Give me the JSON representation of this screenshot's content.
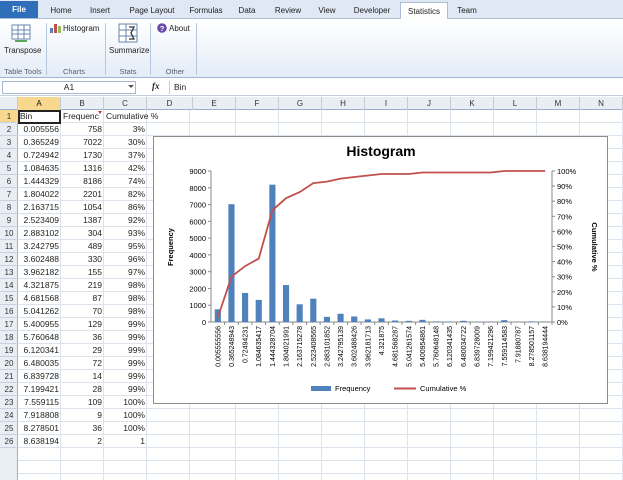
{
  "ribbon_tabs": [
    {
      "label": "File"
    },
    {
      "label": "Home"
    },
    {
      "label": "Insert"
    },
    {
      "label": "Page Layout"
    },
    {
      "label": "Formulas"
    },
    {
      "label": "Data"
    },
    {
      "label": "Review"
    },
    {
      "label": "View"
    },
    {
      "label": "Developer"
    },
    {
      "label": "Statistics"
    },
    {
      "label": "Team"
    }
  ],
  "active_tab": "Statistics",
  "ribbon": {
    "transpose_label": "Transpose",
    "histogram_label": "Histogram",
    "summarize_label": "Summarize",
    "about_label": "About",
    "groups": [
      "Table Tools",
      "Charts",
      "Stats",
      "Other"
    ]
  },
  "formula_bar": {
    "name_box": "A1",
    "fx": "fx",
    "value": "Bin"
  },
  "columns": [
    "A",
    "B",
    "C",
    "D",
    "E",
    "F",
    "G",
    "H",
    "I",
    "J",
    "K",
    "L",
    "M",
    "N"
  ],
  "rows": [
    "1",
    "2",
    "3",
    "4",
    "5",
    "6",
    "7",
    "8",
    "9",
    "10",
    "11",
    "12",
    "13",
    "14",
    "15",
    "16",
    "17",
    "18",
    "19",
    "20",
    "21",
    "22",
    "23",
    "24",
    "25",
    "26"
  ],
  "table": {
    "headers": [
      "Bin",
      "Frequenc",
      "Cumulative %"
    ],
    "rows": [
      [
        "0.005556",
        "758",
        "3%"
      ],
      [
        "0.365249",
        "7022",
        "30%"
      ],
      [
        "0.724942",
        "1730",
        "37%"
      ],
      [
        "1.084635",
        "1316",
        "42%"
      ],
      [
        "1.444329",
        "8186",
        "74%"
      ],
      [
        "1.804022",
        "2201",
        "82%"
      ],
      [
        "2.163715",
        "1054",
        "86%"
      ],
      [
        "2.523409",
        "1387",
        "92%"
      ],
      [
        "2.883102",
        "304",
        "93%"
      ],
      [
        "3.242795",
        "489",
        "95%"
      ],
      [
        "3.602488",
        "330",
        "96%"
      ],
      [
        "3.962182",
        "155",
        "97%"
      ],
      [
        "4.321875",
        "219",
        "98%"
      ],
      [
        "4.681568",
        "87",
        "98%"
      ],
      [
        "5.041262",
        "70",
        "98%"
      ],
      [
        "5.400955",
        "129",
        "99%"
      ],
      [
        "5.760648",
        "36",
        "99%"
      ],
      [
        "6.120341",
        "29",
        "99%"
      ],
      [
        "6.480035",
        "72",
        "99%"
      ],
      [
        "6.839728",
        "14",
        "99%"
      ],
      [
        "7.199421",
        "28",
        "99%"
      ],
      [
        "7.559115",
        "109",
        "100%"
      ],
      [
        "7.918808",
        "9",
        "100%"
      ],
      [
        "8.278501",
        "36",
        "100%"
      ],
      [
        "8.638194",
        "2",
        "1"
      ]
    ]
  },
  "colors": {
    "bar": "#4f81bd",
    "line": "#c0504d",
    "file_tab": "#2f6fba"
  },
  "chart_data": {
    "type": "bar",
    "title": "Histogram",
    "xlabel": "",
    "ylabel": "Frequency",
    "y2label": "Cumulative %",
    "categories": [
      "0.005555556",
      "0.365248943",
      "0.72494231",
      "1.084635417",
      "1.444328704",
      "1.804021991",
      "2.163715278",
      "2.523408565",
      "2.883101852",
      "3.242795139",
      "3.602488426",
      "3.962181713",
      "4.321875",
      "4.681568287",
      "5.041261574",
      "5.400954861",
      "5.760648148",
      "6.120341435",
      "6.480034722",
      "6.839728009",
      "7.199421296",
      "7.559114583",
      "7.91880787",
      "8.278501157",
      "8.638194444"
    ],
    "series": [
      {
        "name": "Frequency",
        "type": "bar",
        "values": [
          758,
          7022,
          1730,
          1316,
          8186,
          2201,
          1054,
          1387,
          304,
          489,
          330,
          155,
          219,
          87,
          70,
          129,
          36,
          29,
          72,
          14,
          28,
          109,
          9,
          36,
          2
        ]
      },
      {
        "name": "Cumulative %",
        "type": "line",
        "axis": "right",
        "values": [
          3,
          30,
          37,
          42,
          74,
          82,
          86,
          92,
          93,
          95,
          96,
          97,
          98,
          98,
          98,
          99,
          99,
          99,
          99,
          99,
          99,
          100,
          100,
          100,
          100
        ]
      }
    ],
    "ylim": [
      0,
      9000
    ],
    "yticks": [
      "0",
      "1000",
      "2000",
      "3000",
      "4000",
      "5000",
      "6000",
      "7000",
      "8000",
      "9000"
    ],
    "y2lim": [
      0,
      100
    ],
    "y2ticks": [
      "0%",
      "10%",
      "20%",
      "30%",
      "40%",
      "50%",
      "60%",
      "70%",
      "80%",
      "90%",
      "100%"
    ],
    "legend": "bottom",
    "grid": false
  }
}
